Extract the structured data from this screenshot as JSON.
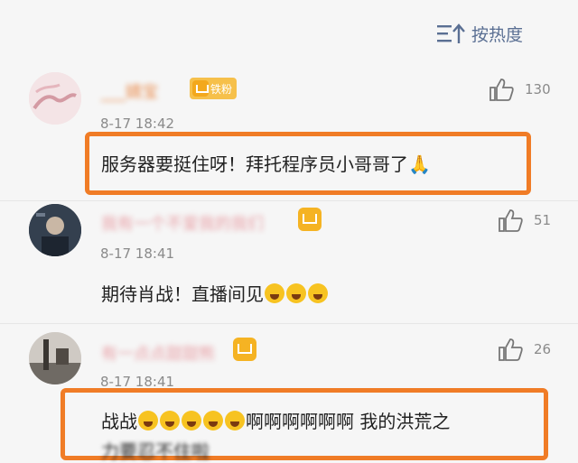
{
  "sort": {
    "label": "按热度",
    "icon": "sort-icon"
  },
  "comments": [
    {
      "username": "___婧宝",
      "badge": "铁粉",
      "time": "8-17 18:42",
      "likes": "130",
      "text": "服务器要挺住呀！拜托程序员小哥哥了🙏"
    },
    {
      "username": "我有一个不爱我的我们",
      "time": "8-17 18:41",
      "likes": "51",
      "text": "期待肖战！直播间见"
    },
    {
      "username": "有一点点甜甜熊",
      "time": "8-17 18:41",
      "likes": "26",
      "text": "战战",
      "text_suffix": "啊啊啊啊啊啊 我的洪荒之",
      "text_line2": "力要忍不住啦"
    }
  ],
  "colors": {
    "highlight": "#f07c26",
    "link": "#5a6f93",
    "badge": "#f6c04a"
  }
}
